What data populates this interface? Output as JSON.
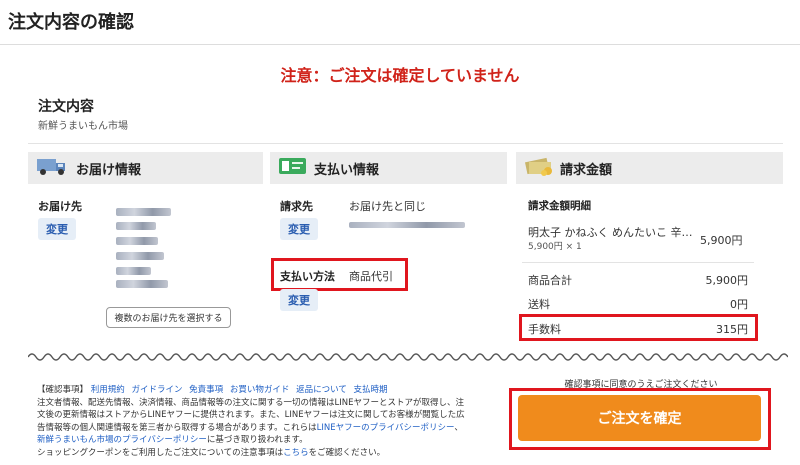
{
  "page_title": "注文内容の確認",
  "warning": "注意：ご注文は確定していません",
  "order": {
    "heading": "注文内容",
    "shop_name": "新鮮うまいもん市場"
  },
  "delivery": {
    "header": "お届け情報",
    "label": "お届け先",
    "change_label": "変更",
    "multi_button": "複数のお届け先を選択する"
  },
  "payment": {
    "header": "支払い情報",
    "billing_label": "請求先",
    "billing_value": "お届け先と同じ",
    "change_label": "変更",
    "method_label": "支払い方法",
    "method_value": "商品代引",
    "method_change_label": "変更"
  },
  "billing": {
    "header": "請求金額",
    "detail_heading": "請求金額明細",
    "item_name": "明太子 かねふく めんたいこ 辛…",
    "item_unit": "5,900円 × 1",
    "item_price": "5,900円",
    "subtotal_label": "商品合計",
    "subtotal_value": "5,900円",
    "shipping_label": "送料",
    "shipping_value": "0円",
    "fee_label": "手数料",
    "fee_value": "315円"
  },
  "notes": {
    "heading": "【確認事項】",
    "links": [
      "利用規約",
      "ガイドライン",
      "免責事項",
      "お買い物ガイド",
      "返品について",
      "支払時期"
    ],
    "line1": "注文者情報、配送先情報、決済情報、商品情報等の注文に関する一切の情報はLINEヤフーとストアが取得し、注",
    "line2": "文後の更新情報はストアからLINEヤフーに提供されます。また、LINEヤフーは注文に関してお客様が閲覧した広",
    "line3a": "告情報等の個人関連情報を第三者から取得する場合があります。これらは",
    "line3_link": "LINEヤフーのプライバシーポリシー",
    "line3b": "、",
    "line4_link": "新鮮うまいもん市場のプライバシーポリシー",
    "line4b": "に基づき取り扱われます。",
    "line5a": "ショッピングクーポンをご利用したご注文についての注意事項は",
    "line5_link": "こちら",
    "line5b": "をご確認ください。"
  },
  "confirm": {
    "agree_text": "確認事項に同意のうえご注文ください",
    "button_label": "ご注文を確定"
  }
}
